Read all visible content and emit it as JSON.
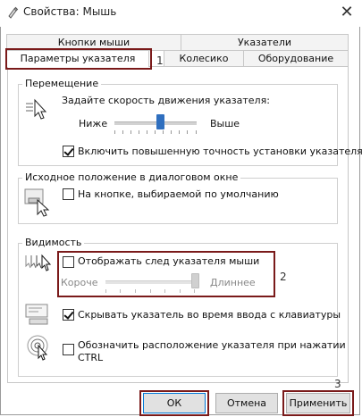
{
  "window": {
    "title": "Свойства: Мышь",
    "close_label": "✕"
  },
  "tabs": {
    "row1": [
      "Кнопки мыши",
      "Указатели"
    ],
    "row2": [
      "Параметры указателя",
      "Колесико",
      "Оборудование"
    ],
    "active": "Параметры указателя"
  },
  "motion": {
    "title": "Перемещение",
    "speed_label": "Задайте скорость движения указателя:",
    "low": "Ниже",
    "high": "Выше",
    "speed_level": 0.55,
    "precision_label": "Включить повышенную точность установки указателя",
    "precision_checked": true
  },
  "snap": {
    "title": "Исходное положение в диалоговом окне",
    "snap_label": "На кнопке, выбираемой по умолчанию",
    "snap_checked": false
  },
  "visibility": {
    "title": "Видимость",
    "trails_label": "Отображать след указателя мыши",
    "trails_checked": false,
    "short": "Короче",
    "long": "Длиннее",
    "trails_level": 1.0,
    "hide_label": "Скрывать указатель во время ввода с клавиатуры",
    "hide_checked": true,
    "ctrl_label_line1": "Обозначить расположение указателя при нажатии",
    "ctrl_label_line2": "CTRL",
    "ctrl_checked": false
  },
  "buttons": {
    "ok": "ОК",
    "cancel": "Отмена",
    "apply": "Применить"
  },
  "annotations": {
    "n1": "1",
    "n2": "2",
    "n3": "3"
  },
  "colors": {
    "accent_thumb": "#2f6fbf",
    "disabled_thumb": "#d0d0d0",
    "annotation_box": "#7a1a1a"
  }
}
